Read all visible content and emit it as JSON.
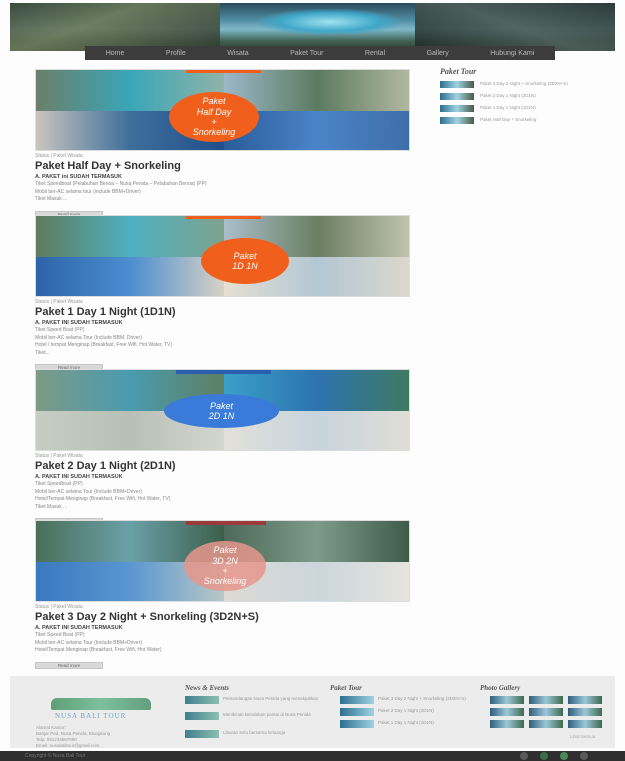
{
  "nav": [
    "Home",
    "Profile",
    "Wisata",
    "Paket Tour",
    "Rental",
    "Gallery",
    "Hubungi Kami"
  ],
  "posts": [
    {
      "badge": [
        "Paket",
        "Half Day",
        "+",
        "Snorkeling"
      ],
      "meta": "Status | Paket Wisata",
      "title": "Paket Half Day + Snorkeling",
      "subtitle": "A. PAKET ini SUDAH TERMASUK",
      "lines": [
        "Tiket Speedboat (Pelabuhan Benoa – Nusa Penida – Pelabuhan Benoa) (PP)",
        "Mobil ber-AC selama tour (include BBM+Driver)",
        "Tiket Masuk ..."
      ],
      "more": "Read more"
    },
    {
      "badge": [
        "Paket",
        "1D 1N"
      ],
      "meta": "Status | Paket Wisata",
      "title": "Paket 1 Day 1 Night (1D1N)",
      "subtitle": "A. PAKET INI SUDAH TERMASUK",
      "lines": [
        "Tiket Speed Boat (PP)",
        "Mobil ber-AC selama Tour (Include BBM, Driver)",
        "Hotel / tempat Menginap (Breakfast, Free Wifi, Hot Water, TV)",
        "Tiket..."
      ],
      "more": "Read more"
    },
    {
      "badge": [
        "Paket",
        "2D 1N"
      ],
      "meta": "Status | Paket Wisata",
      "title": "Paket 2 Day 1 Night (2D1N)",
      "subtitle": "A. PAKET INI SUDAH TERMASUK",
      "lines": [
        "Tiket Speedboat (PP)",
        "Mobil ber-AC selama Tour (Include BBM+Driver)",
        "Hotel/Tempat Menginap (Breakfast, Free Wifi, Hot Water, TV)",
        "Tiket Masuk ..."
      ],
      "more": "Read more"
    },
    {
      "badge": [
        "Paket",
        "3D 2N",
        "+",
        "Snorkeling"
      ],
      "meta": "Status | Paket Wisata",
      "title": "Paket 3 Day 2 Night + Snorkeling (3D2N+S)",
      "subtitle": "A. PAKET INI SUDAH TERMASUK",
      "lines": [
        "Tiket Speed Boat (PP)",
        "Mobil ber-AC selama Tour (Include BBM+Driver)",
        "Hotel/Tempat Menginap (Breakfast, Free Wifi, Hot Water)"
      ],
      "more": "Read more"
    }
  ],
  "sidebar": {
    "title": "Paket Tour",
    "items": [
      "Paket 3 Day 2 Night + Snorkeling (3D2N+S)",
      "Paket 2 Day 1 Night (2D1N)",
      "Paket 1 Day 1 Night (1D1N)",
      "Paket Half Day + Snorkeling"
    ]
  },
  "footer": {
    "logo": "NUSA BALI TOUR",
    "address": [
      "Alamat Kantor:",
      "Banjar Ped, Nusa Penida, Klungkung",
      "Telp: 081234567890",
      "Email: nusabalitour@gmail.com"
    ],
    "news_title": "News & Events",
    "news": [
      "Pemandangan Nusa Penida yang menakjubkan",
      "Menikmati keindahan pantai di Nusa Penida",
      "Liburan seru bersama keluarga"
    ],
    "tour_title": "Paket Tour",
    "tours": [
      "Paket 3 Day 2 Night + Snorkeling (3D2N+S)",
      "Paket 2 Day 1 Night (2D1N)",
      "Paket 1 Day 1 Night (1D1N)"
    ],
    "gallery_title": "Photo Gallery",
    "gallery_more": "Lihat Semua"
  },
  "copyright": "Copyright © Nusa Bali Tour",
  "colors": {
    "orange_badge": "#f0601c",
    "blue_badge": "#3a7ad8",
    "nav_bg": "#3c3c3c"
  }
}
